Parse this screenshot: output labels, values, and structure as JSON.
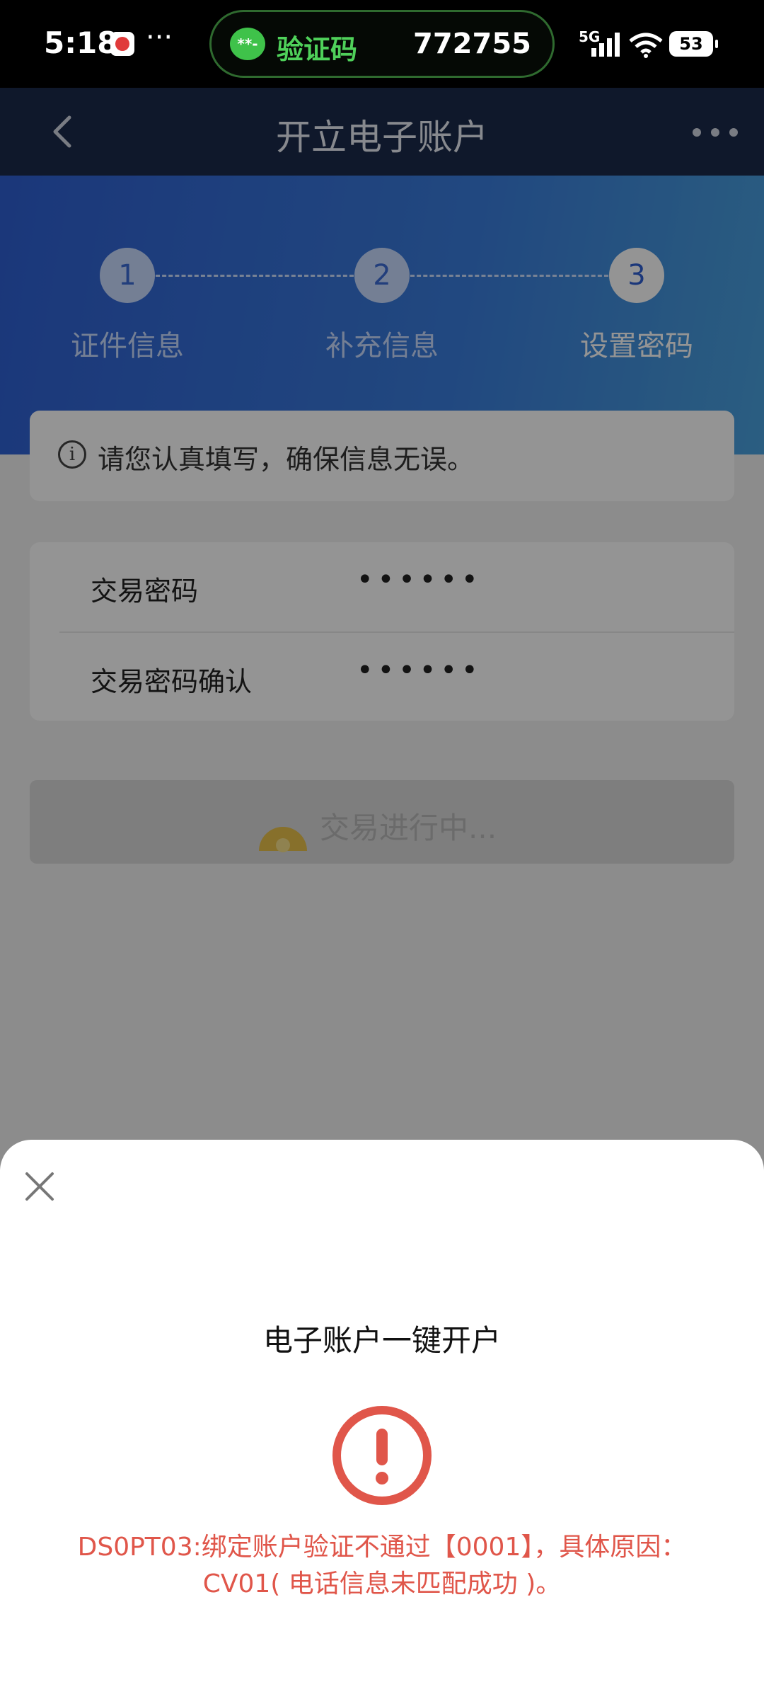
{
  "status_bar": {
    "time": "5:18",
    "more": "···",
    "otp_label": "验证码",
    "otp_code": "772755",
    "network": "5G",
    "battery": "53",
    "otp_icon_text": "**-"
  },
  "nav": {
    "title": "开立电子账户"
  },
  "steps": [
    {
      "number": "1",
      "label": "证件信息",
      "active": false
    },
    {
      "number": "2",
      "label": "补充信息",
      "active": false
    },
    {
      "number": "3",
      "label": "设置密码",
      "active": true
    }
  ],
  "notice": {
    "text": "请您认真填写，确保信息无误。"
  },
  "form": {
    "rows": [
      {
        "label": "交易密码",
        "value": "••••••"
      },
      {
        "label": "交易密码确认",
        "value": "••••••"
      }
    ]
  },
  "submit": {
    "label": "交易进行中..."
  },
  "sheet": {
    "title": "电子账户一键开户",
    "error_line1": "DS0PT03:绑定账户验证不通过【0001】，具体原因：",
    "error_line2": "CV01( 电话信息未匹配成功 )。"
  },
  "colors": {
    "nav_bg": "#1b2a4a",
    "hero_start": "#2f5fd3",
    "hero_end": "#4aa2de",
    "error_red": "#e0564a",
    "otp_green": "#4fd15a"
  },
  "icons": [
    "back-icon",
    "more-icon",
    "info-icon",
    "close-icon",
    "error-icon",
    "wifi-icon",
    "signal-icon",
    "message-icon"
  ]
}
